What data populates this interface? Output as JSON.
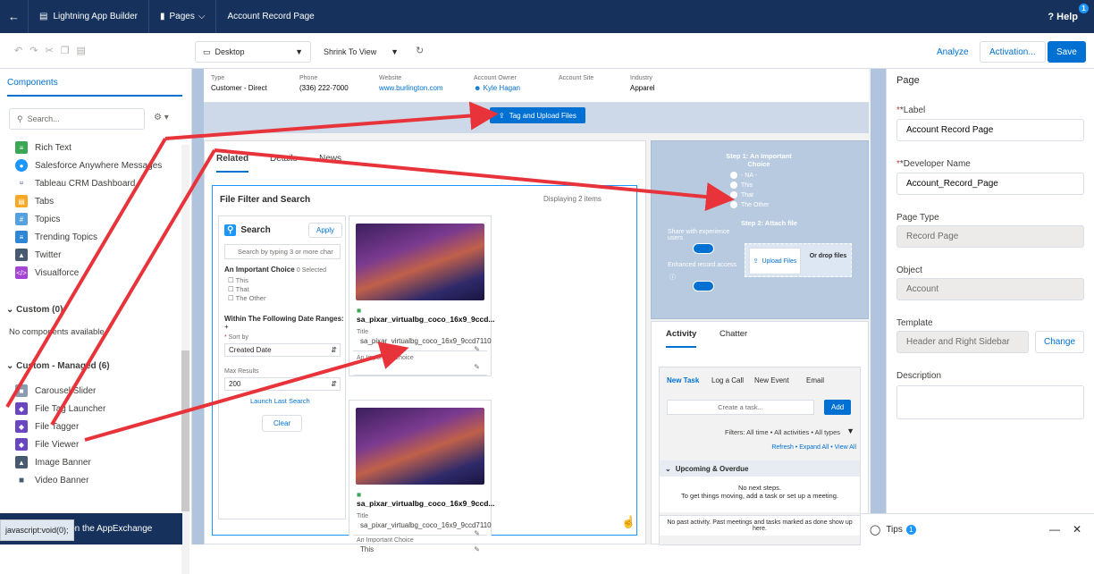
{
  "topbar": {
    "back_icon": "back-arrow-icon",
    "app": "Lightning App Builder",
    "pages": "Pages",
    "page_name": "Account Record Page",
    "help": "Help",
    "help_count": "1"
  },
  "toolbar": {
    "device": "Desktop",
    "view": "Shrink To View",
    "analyze": "Analyze",
    "activation": "Activation...",
    "save": "Save"
  },
  "left": {
    "tab": "Components",
    "search_placeholder": "Search...",
    "items": [
      "Rich Text",
      "Salesforce Anywhere Messages",
      "Tableau CRM Dashboard",
      "Tabs",
      "Topics",
      "Trending Topics",
      "Twitter",
      "Visualforce"
    ],
    "custom_header": "Custom (0)",
    "custom_empty": "No components available.",
    "managed_header": "Custom - Managed (6)",
    "managed_items": [
      "Carousel/Slider",
      "File Tag Launcher",
      "File Tagger",
      "File Viewer",
      "Image Banner",
      "Video Banner"
    ],
    "appexchange": "Get more on the AppExchange",
    "status": "javascript:void(0);"
  },
  "record_header": {
    "type_label": "Type",
    "type": "Customer - Direct",
    "phone_label": "Phone",
    "phone": "(336) 222-7000",
    "website_label": "Website",
    "website": "www.burlington.com",
    "owner_label": "Account Owner",
    "owner": "Kyle Hagan",
    "site_label": "Account Site",
    "industry_label": "Industry",
    "industry": "Apparel"
  },
  "upload_button": "Tag and Upload Files",
  "main": {
    "tabs": [
      "Related",
      "Details",
      "News"
    ],
    "ffs_title": "File Filter and Search",
    "displaying": "Displaying 2 items",
    "search_title": "Search",
    "apply": "Apply",
    "search_placeholder": "Search by typing 3 or more char",
    "choice_label": "An Important Choice",
    "choice_selected": "0 Selected",
    "choices": [
      "This",
      "That",
      "The Other"
    ],
    "date_label": "Within The Following Date Ranges:",
    "sort_label": "Sort by",
    "sort_value": "Created Date",
    "max_label": "Max Results",
    "max_value": "200",
    "launch": "Launch Last Search",
    "clear": "Clear",
    "files": [
      {
        "name": "sa_pixar_virtualbg_coco_16x9_9ccd...",
        "title_label": "Title",
        "title": "sa_pixar_virtualbg_coco_16x9_9ccd7110",
        "choice_label": "An Important Choice",
        "choice": ""
      },
      {
        "name": "sa_pixar_virtualbg_coco_16x9_9ccd...",
        "title_label": "Title",
        "title": "sa_pixar_virtualbg_coco_16x9_9ccd7110",
        "choice_label": "An Important Choice",
        "choice": "This"
      }
    ]
  },
  "tagger": {
    "step1": "Step 1: An Important Choice",
    "options": [
      "- NA -",
      "This",
      "That",
      "The Other"
    ],
    "step2": "Step 2: Attach file",
    "share": "Share with experience users",
    "enhanced": "Enhanced record access",
    "upload": "Upload Files",
    "drop": "Or drop files"
  },
  "activity": {
    "tabs": [
      "Activity",
      "Chatter"
    ],
    "subtabs": [
      "New Task",
      "Log a Call",
      "New Event",
      "Email"
    ],
    "create_placeholder": "Create a task...",
    "add": "Add",
    "filters": "Filters: All time • All activities • All types",
    "links": "Refresh • Expand All • View All",
    "upcoming": "Upcoming & Overdue",
    "no_steps": "No next steps.",
    "no_steps_sub": "To get things moving, add a task or set up a meeting.",
    "no_past": "No past activity. Past meetings and tasks marked as done show up here."
  },
  "props": {
    "title": "Page",
    "label_label": "*Label",
    "label": "Account Record Page",
    "dev_label": "*Developer Name",
    "dev": "Account_Record_Page",
    "type_label": "Page Type",
    "type": "Record Page",
    "object_label": "Object",
    "object": "Account",
    "template_label": "Template",
    "template": "Header and Right Sidebar",
    "change": "Change",
    "desc_label": "Description"
  },
  "tips": {
    "label": "Tips",
    "count": "1"
  }
}
